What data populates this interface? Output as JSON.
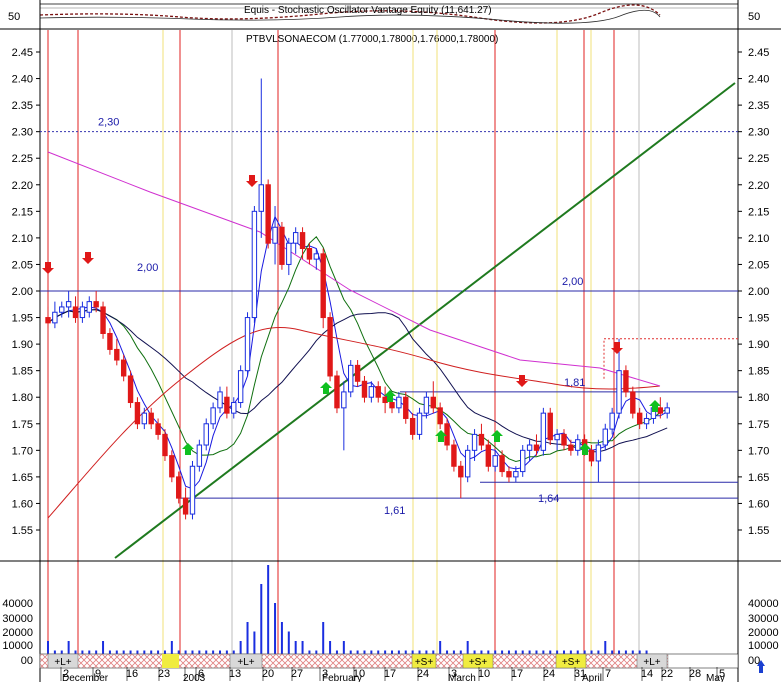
{
  "header": {
    "indicator_title": "Equis - Stochastic Oscillator Vantage Equity (11,641.27)",
    "stoch_value": "50",
    "security_title": "PTBVLSONAECOM (1.77000,1.78000,1.76000,1.78000)"
  },
  "chart_data": {
    "type": "candlestick",
    "price_axis": {
      "min": 1.5,
      "max": 2.5,
      "ticks": [
        "2.45",
        "2.40",
        "2.35",
        "2.30",
        "2.25",
        "2.20",
        "2.15",
        "2.10",
        "2.05",
        "2.00",
        "1.95",
        "1.90",
        "1.85",
        "1.80",
        "1.75",
        "1.70",
        "1.65",
        "1.60",
        "1.55"
      ]
    },
    "volume_axis": {
      "ticks": [
        "40000",
        "30000",
        "20000",
        "10000",
        "00"
      ]
    },
    "x_axis": {
      "day_ticks": [
        "2",
        "9",
        "16",
        "23",
        "30",
        "6",
        "13",
        "20",
        "27",
        "3",
        "10",
        "17",
        "24",
        "3",
        "10",
        "17",
        "24",
        "31",
        "7",
        "14",
        "22",
        "28",
        "5"
      ],
      "months": [
        "December",
        "2003",
        "February",
        "March",
        "April",
        "May"
      ]
    },
    "level_lines": [
      {
        "value": 2.3,
        "label": "2,30",
        "style": "dotted"
      },
      {
        "value": 2.0,
        "label": "2,00",
        "style": "solid"
      },
      {
        "value": 1.81,
        "label": "1,81",
        "style": "solid"
      },
      {
        "value": 1.64,
        "label": "1,64",
        "style": "solid"
      },
      {
        "value": 1.61,
        "label": "1,61",
        "style": "solid"
      },
      {
        "value": 1.91,
        "label": "",
        "style": "dotted-red"
      }
    ],
    "candles": [
      [
        1.95,
        1.97,
        1.93,
        1.94
      ],
      [
        1.94,
        1.98,
        1.93,
        1.96
      ],
      [
        1.96,
        1.98,
        1.95,
        1.97
      ],
      [
        1.97,
        2.0,
        1.95,
        1.98
      ],
      [
        1.97,
        1.99,
        1.94,
        1.95
      ],
      [
        1.95,
        1.98,
        1.94,
        1.97
      ],
      [
        1.96,
        1.99,
        1.95,
        1.98
      ],
      [
        1.98,
        2.0,
        1.96,
        1.97
      ],
      [
        1.97,
        1.98,
        1.91,
        1.92
      ],
      [
        1.92,
        1.93,
        1.88,
        1.89
      ],
      [
        1.89,
        1.91,
        1.86,
        1.87
      ],
      [
        1.87,
        1.88,
        1.83,
        1.84
      ],
      [
        1.84,
        1.85,
        1.78,
        1.79
      ],
      [
        1.79,
        1.8,
        1.74,
        1.75
      ],
      [
        1.75,
        1.78,
        1.74,
        1.77
      ],
      [
        1.77,
        1.78,
        1.74,
        1.75
      ],
      [
        1.75,
        1.76,
        1.72,
        1.73
      ],
      [
        1.73,
        1.74,
        1.68,
        1.69
      ],
      [
        1.69,
        1.7,
        1.64,
        1.65
      ],
      [
        1.65,
        1.66,
        1.6,
        1.61
      ],
      [
        1.61,
        1.63,
        1.57,
        1.58
      ],
      [
        1.58,
        1.68,
        1.57,
        1.67
      ],
      [
        1.67,
        1.72,
        1.66,
        1.71
      ],
      [
        1.71,
        1.76,
        1.7,
        1.75
      ],
      [
        1.75,
        1.79,
        1.74,
        1.78
      ],
      [
        1.78,
        1.82,
        1.77,
        1.81
      ],
      [
        1.8,
        1.82,
        1.76,
        1.77
      ],
      [
        1.77,
        1.8,
        1.76,
        1.79
      ],
      [
        1.79,
        1.86,
        1.78,
        1.85
      ],
      [
        1.85,
        1.96,
        1.84,
        1.95
      ],
      [
        1.95,
        2.16,
        1.94,
        2.15
      ],
      [
        2.15,
        2.4,
        2.1,
        2.2
      ],
      [
        2.2,
        2.21,
        2.08,
        2.09
      ],
      [
        2.09,
        2.16,
        2.05,
        2.12
      ],
      [
        2.12,
        2.13,
        2.04,
        2.05
      ],
      [
        2.05,
        2.1,
        2.03,
        2.09
      ],
      [
        2.09,
        2.12,
        2.07,
        2.11
      ],
      [
        2.11,
        2.12,
        2.06,
        2.08
      ],
      [
        2.08,
        2.09,
        2.05,
        2.06
      ],
      [
        2.06,
        2.08,
        2.04,
        2.07
      ],
      [
        2.07,
        2.08,
        1.93,
        1.95
      ],
      [
        1.95,
        1.96,
        1.83,
        1.84
      ],
      [
        1.84,
        1.85,
        1.77,
        1.78
      ],
      [
        1.78,
        1.83,
        1.7,
        1.81
      ],
      [
        1.81,
        1.87,
        1.8,
        1.86
      ],
      [
        1.86,
        1.87,
        1.82,
        1.83
      ],
      [
        1.83,
        1.84,
        1.79,
        1.8
      ],
      [
        1.8,
        1.83,
        1.79,
        1.82
      ],
      [
        1.82,
        1.83,
        1.79,
        1.8
      ],
      [
        1.8,
        1.82,
        1.77,
        1.79
      ],
      [
        1.79,
        1.8,
        1.77,
        1.78
      ],
      [
        1.78,
        1.81,
        1.77,
        1.8
      ],
      [
        1.8,
        1.81,
        1.75,
        1.76
      ],
      [
        1.76,
        1.77,
        1.72,
        1.73
      ],
      [
        1.73,
        1.78,
        1.72,
        1.77
      ],
      [
        1.77,
        1.81,
        1.76,
        1.8
      ],
      [
        1.8,
        1.83,
        1.77,
        1.78
      ],
      [
        1.78,
        1.79,
        1.74,
        1.75
      ],
      [
        1.75,
        1.76,
        1.7,
        1.71
      ],
      [
        1.71,
        1.72,
        1.66,
        1.67
      ],
      [
        1.67,
        1.68,
        1.61,
        1.65
      ],
      [
        1.65,
        1.71,
        1.64,
        1.7
      ],
      [
        1.7,
        1.74,
        1.68,
        1.73
      ],
      [
        1.73,
        1.75,
        1.7,
        1.71
      ],
      [
        1.71,
        1.72,
        1.66,
        1.67
      ],
      [
        1.67,
        1.7,
        1.66,
        1.69
      ],
      [
        1.69,
        1.7,
        1.65,
        1.66
      ],
      [
        1.66,
        1.67,
        1.64,
        1.65
      ],
      [
        1.65,
        1.67,
        1.64,
        1.66
      ],
      [
        1.66,
        1.71,
        1.65,
        1.7
      ],
      [
        1.7,
        1.72,
        1.68,
        1.71
      ],
      [
        1.71,
        1.73,
        1.69,
        1.7
      ],
      [
        1.7,
        1.78,
        1.69,
        1.77
      ],
      [
        1.77,
        1.78,
        1.71,
        1.72
      ],
      [
        1.72,
        1.74,
        1.7,
        1.73
      ],
      [
        1.73,
        1.74,
        1.7,
        1.71
      ],
      [
        1.71,
        1.72,
        1.69,
        1.7
      ],
      [
        1.7,
        1.73,
        1.69,
        1.72
      ],
      [
        1.72,
        1.73,
        1.69,
        1.7
      ],
      [
        1.7,
        1.71,
        1.67,
        1.68
      ],
      [
        1.68,
        1.72,
        1.64,
        1.71
      ],
      [
        1.71,
        1.75,
        1.7,
        1.74
      ],
      [
        1.74,
        1.78,
        1.73,
        1.77
      ],
      [
        1.77,
        1.91,
        1.76,
        1.85
      ],
      [
        1.85,
        1.86,
        1.8,
        1.81
      ],
      [
        1.81,
        1.82,
        1.76,
        1.77
      ],
      [
        1.77,
        1.78,
        1.74,
        1.75
      ],
      [
        1.75,
        1.77,
        1.74,
        1.76
      ],
      [
        1.76,
        1.79,
        1.75,
        1.78
      ],
      [
        1.78,
        1.8,
        1.76,
        1.77
      ],
      [
        1.77,
        1.79,
        1.76,
        1.78
      ]
    ],
    "volumes": [
      2,
      1,
      1,
      2,
      1,
      1,
      1,
      1,
      2,
      1,
      1,
      1,
      1,
      1,
      1,
      1,
      1,
      1,
      2,
      1,
      1,
      1,
      1,
      1,
      1,
      1,
      1,
      1,
      2,
      4,
      3,
      8,
      10,
      6,
      4,
      3,
      2,
      2,
      1,
      1,
      4,
      2,
      1,
      2,
      1,
      1,
      1,
      1,
      1,
      1,
      1,
      1,
      1,
      1,
      1,
      1,
      1,
      2,
      1,
      1,
      1,
      2,
      1,
      1,
      1,
      1,
      1,
      1,
      1,
      1,
      1,
      1,
      1,
      1,
      1,
      1,
      1,
      1,
      1,
      1,
      1,
      2,
      1,
      1,
      1,
      1,
      1,
      1
    ],
    "annotations": {
      "signals": [
        "+L+",
        "+L+",
        "+S+",
        "+S+",
        "+S+",
        "+L+"
      ]
    }
  }
}
